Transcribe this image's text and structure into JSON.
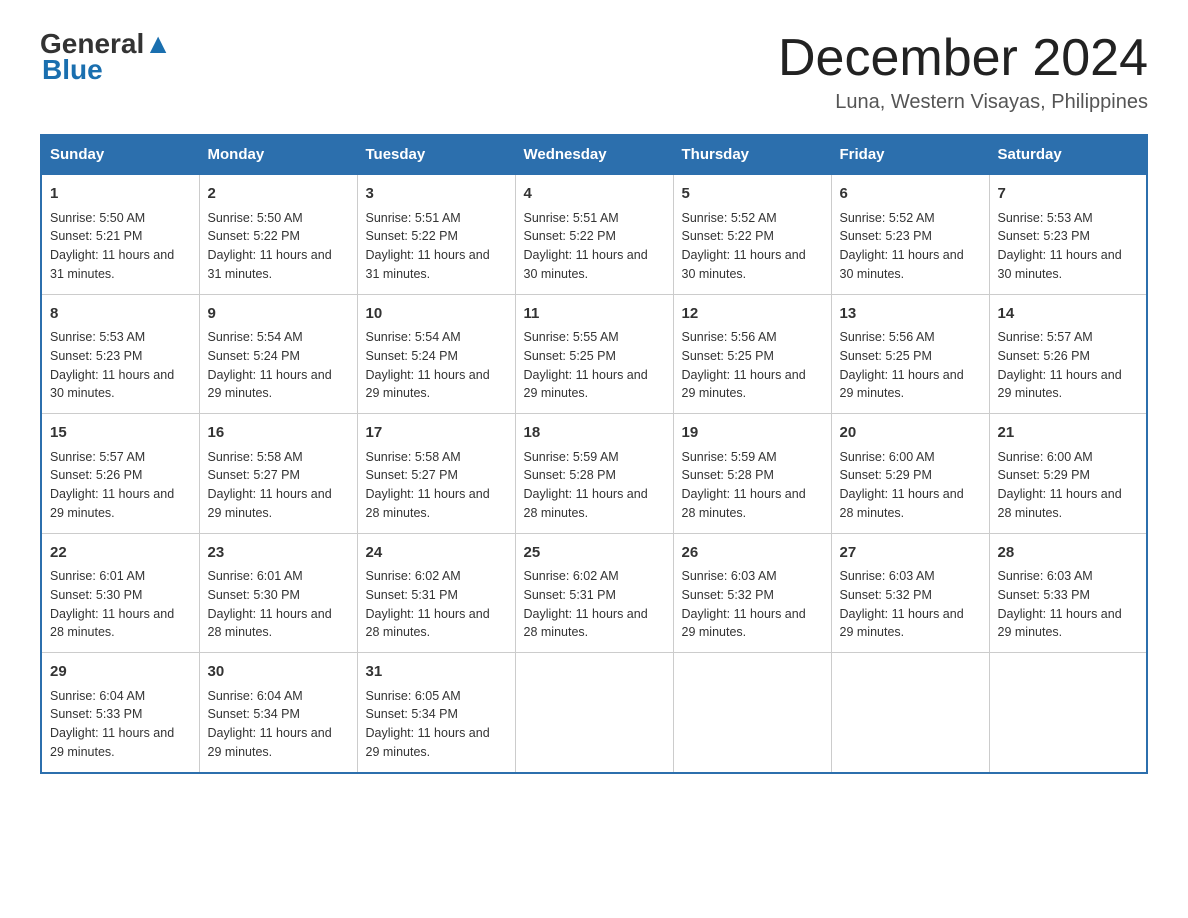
{
  "header": {
    "logo_general": "General",
    "logo_blue": "Blue",
    "month_title": "December 2024",
    "location": "Luna, Western Visayas, Philippines"
  },
  "weekdays": [
    "Sunday",
    "Monday",
    "Tuesday",
    "Wednesday",
    "Thursday",
    "Friday",
    "Saturday"
  ],
  "weeks": [
    [
      {
        "day": "1",
        "sunrise": "5:50 AM",
        "sunset": "5:21 PM",
        "daylight": "11 hours and 31 minutes."
      },
      {
        "day": "2",
        "sunrise": "5:50 AM",
        "sunset": "5:22 PM",
        "daylight": "11 hours and 31 minutes."
      },
      {
        "day": "3",
        "sunrise": "5:51 AM",
        "sunset": "5:22 PM",
        "daylight": "11 hours and 31 minutes."
      },
      {
        "day": "4",
        "sunrise": "5:51 AM",
        "sunset": "5:22 PM",
        "daylight": "11 hours and 30 minutes."
      },
      {
        "day": "5",
        "sunrise": "5:52 AM",
        "sunset": "5:22 PM",
        "daylight": "11 hours and 30 minutes."
      },
      {
        "day": "6",
        "sunrise": "5:52 AM",
        "sunset": "5:23 PM",
        "daylight": "11 hours and 30 minutes."
      },
      {
        "day": "7",
        "sunrise": "5:53 AM",
        "sunset": "5:23 PM",
        "daylight": "11 hours and 30 minutes."
      }
    ],
    [
      {
        "day": "8",
        "sunrise": "5:53 AM",
        "sunset": "5:23 PM",
        "daylight": "11 hours and 30 minutes."
      },
      {
        "day": "9",
        "sunrise": "5:54 AM",
        "sunset": "5:24 PM",
        "daylight": "11 hours and 29 minutes."
      },
      {
        "day": "10",
        "sunrise": "5:54 AM",
        "sunset": "5:24 PM",
        "daylight": "11 hours and 29 minutes."
      },
      {
        "day": "11",
        "sunrise": "5:55 AM",
        "sunset": "5:25 PM",
        "daylight": "11 hours and 29 minutes."
      },
      {
        "day": "12",
        "sunrise": "5:56 AM",
        "sunset": "5:25 PM",
        "daylight": "11 hours and 29 minutes."
      },
      {
        "day": "13",
        "sunrise": "5:56 AM",
        "sunset": "5:25 PM",
        "daylight": "11 hours and 29 minutes."
      },
      {
        "day": "14",
        "sunrise": "5:57 AM",
        "sunset": "5:26 PM",
        "daylight": "11 hours and 29 minutes."
      }
    ],
    [
      {
        "day": "15",
        "sunrise": "5:57 AM",
        "sunset": "5:26 PM",
        "daylight": "11 hours and 29 minutes."
      },
      {
        "day": "16",
        "sunrise": "5:58 AM",
        "sunset": "5:27 PM",
        "daylight": "11 hours and 29 minutes."
      },
      {
        "day": "17",
        "sunrise": "5:58 AM",
        "sunset": "5:27 PM",
        "daylight": "11 hours and 28 minutes."
      },
      {
        "day": "18",
        "sunrise": "5:59 AM",
        "sunset": "5:28 PM",
        "daylight": "11 hours and 28 minutes."
      },
      {
        "day": "19",
        "sunrise": "5:59 AM",
        "sunset": "5:28 PM",
        "daylight": "11 hours and 28 minutes."
      },
      {
        "day": "20",
        "sunrise": "6:00 AM",
        "sunset": "5:29 PM",
        "daylight": "11 hours and 28 minutes."
      },
      {
        "day": "21",
        "sunrise": "6:00 AM",
        "sunset": "5:29 PM",
        "daylight": "11 hours and 28 minutes."
      }
    ],
    [
      {
        "day": "22",
        "sunrise": "6:01 AM",
        "sunset": "5:30 PM",
        "daylight": "11 hours and 28 minutes."
      },
      {
        "day": "23",
        "sunrise": "6:01 AM",
        "sunset": "5:30 PM",
        "daylight": "11 hours and 28 minutes."
      },
      {
        "day": "24",
        "sunrise": "6:02 AM",
        "sunset": "5:31 PM",
        "daylight": "11 hours and 28 minutes."
      },
      {
        "day": "25",
        "sunrise": "6:02 AM",
        "sunset": "5:31 PM",
        "daylight": "11 hours and 28 minutes."
      },
      {
        "day": "26",
        "sunrise": "6:03 AM",
        "sunset": "5:32 PM",
        "daylight": "11 hours and 29 minutes."
      },
      {
        "day": "27",
        "sunrise": "6:03 AM",
        "sunset": "5:32 PM",
        "daylight": "11 hours and 29 minutes."
      },
      {
        "day": "28",
        "sunrise": "6:03 AM",
        "sunset": "5:33 PM",
        "daylight": "11 hours and 29 minutes."
      }
    ],
    [
      {
        "day": "29",
        "sunrise": "6:04 AM",
        "sunset": "5:33 PM",
        "daylight": "11 hours and 29 minutes."
      },
      {
        "day": "30",
        "sunrise": "6:04 AM",
        "sunset": "5:34 PM",
        "daylight": "11 hours and 29 minutes."
      },
      {
        "day": "31",
        "sunrise": "6:05 AM",
        "sunset": "5:34 PM",
        "daylight": "11 hours and 29 minutes."
      },
      null,
      null,
      null,
      null
    ]
  ],
  "labels": {
    "sunrise": "Sunrise:",
    "sunset": "Sunset:",
    "daylight": "Daylight:"
  }
}
